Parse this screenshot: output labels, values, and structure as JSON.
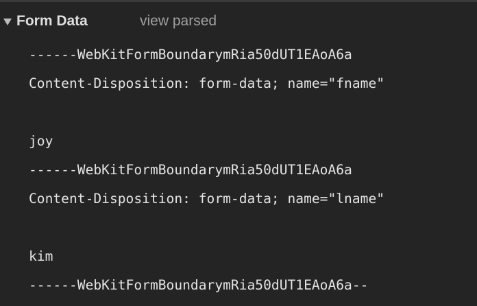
{
  "form_data": {
    "title": "Form Data",
    "view_toggle_label": "view parsed",
    "lines": [
      "------WebKitFormBoundarymRia50dUT1EAoA6a",
      "Content-Disposition: form-data; name=\"fname\"",
      "",
      "joy",
      "------WebKitFormBoundarymRia50dUT1EAoA6a",
      "Content-Disposition: form-data; name=\"lname\"",
      "",
      "kim",
      "------WebKitFormBoundarymRia50dUT1EAoA6a--"
    ]
  },
  "icons": {
    "expand": "triangle-down-icon"
  },
  "colors": {
    "background": "#242424",
    "text": "#e3e3e3",
    "secondary_text": "#a0a0a0"
  }
}
